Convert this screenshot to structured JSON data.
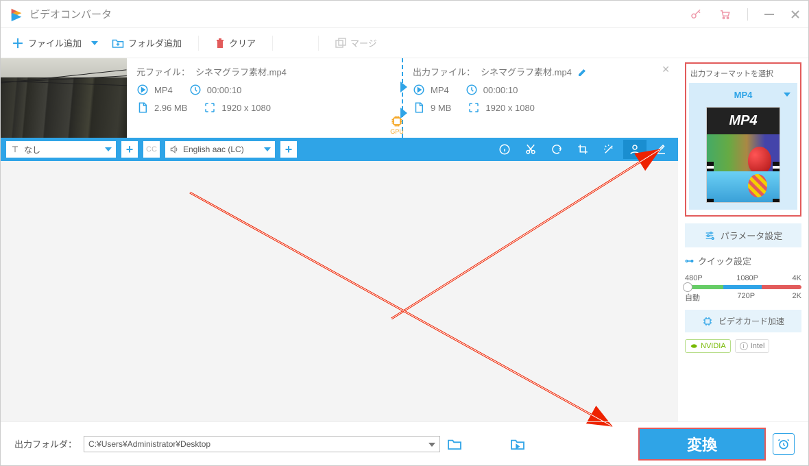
{
  "window": {
    "title": "ビデオコンバータ"
  },
  "toolbar": {
    "add_file": "ファイル追加",
    "add_folder": "フォルダ追加",
    "clear": "クリア",
    "merge": "マージ"
  },
  "item": {
    "source": {
      "label": "元ファイル：",
      "name": "シネマグラフ素材.mp4",
      "format": "MP4",
      "duration": "00:00:10",
      "size": "2.96 MB",
      "resolution": "1920 x 1080"
    },
    "output": {
      "label": "出力ファイル：",
      "name": "シネマグラフ素材.mp4",
      "format": "MP4",
      "duration": "00:00:10",
      "size": "9 MB",
      "resolution": "1920 x 1080"
    },
    "gpu": "GPU"
  },
  "editbar": {
    "subtitle_none": "なし",
    "audio_track": "English aac (LC)"
  },
  "side": {
    "format_label": "出力フォーマットを選択",
    "selected_format": "MP4",
    "preview_badge": "MP4",
    "param_settings": "パラメータ設定",
    "quick_label": "クイック設定",
    "presets_top": {
      "a": "480P",
      "b": "1080P",
      "c": "4K"
    },
    "presets_bottom": {
      "a": "自動",
      "b": "720P",
      "c": "2K"
    },
    "gpu_accel": "ビデオカード加速",
    "chips": {
      "nvidia": "NVIDIA",
      "intel": "Intel"
    }
  },
  "footer": {
    "out_label": "出力フォルダ：",
    "out_path": "C:¥Users¥Administrator¥Desktop",
    "convert": "変換"
  }
}
